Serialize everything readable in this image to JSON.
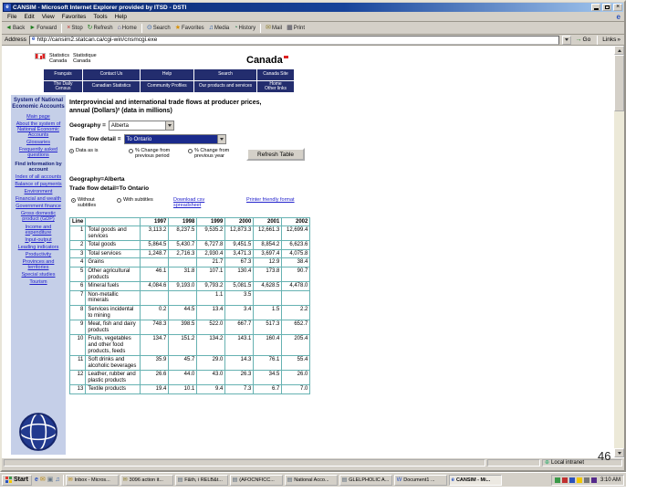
{
  "slide": {
    "page_number": "46"
  },
  "window": {
    "title": "CANSIM - Microsoft Internet Explorer provided by ITSD - DSTI",
    "menu": [
      "File",
      "Edit",
      "View",
      "Favorites",
      "Tools",
      "Help"
    ],
    "toolbar": [
      {
        "label": "Back",
        "icon": "back-arrow-icon"
      },
      {
        "label": "Forward",
        "icon": "forward-arrow-icon"
      },
      {
        "label": "Stop",
        "icon": "stop-icon"
      },
      {
        "label": "Refresh",
        "icon": "refresh-icon"
      },
      {
        "label": "Home",
        "icon": "home-icon"
      },
      {
        "label": "Search",
        "icon": "search-icon"
      },
      {
        "label": "Favorites",
        "icon": "favorites-icon"
      },
      {
        "label": "Media",
        "icon": "media-icon"
      },
      {
        "label": "History",
        "icon": "history-icon"
      },
      {
        "label": "Mail",
        "icon": "mail-icon"
      },
      {
        "label": "Print",
        "icon": "print-icon"
      }
    ],
    "address": {
      "label": "Address",
      "value": "http://cansim2.statcan.ca/cgi-win/cnsmcgi.exe",
      "go": "Go",
      "links": "Links"
    },
    "status": {
      "zone": "Local intranet"
    }
  },
  "site_header": {
    "signature": {
      "english": "Statistics\nCanada",
      "french": "Statistique\nCanada"
    },
    "wordmark": "Canada",
    "nav_row1": [
      "Français",
      "Contact Us",
      "Help",
      "Search",
      "Canada Site"
    ],
    "nav_row2": [
      "The Daily\nCensus",
      "Canadian Statistics",
      "Community Profiles",
      "Our products and services",
      "Home\nOther links"
    ]
  },
  "sidebar": {
    "title": "System of National Economic Accounts",
    "items": [
      {
        "label": "Main page",
        "type": "link"
      },
      {
        "label": "About the system of National Economic Accounts",
        "type": "link"
      },
      {
        "label": "Glossaries",
        "type": "link"
      },
      {
        "label": "Frequently asked questions",
        "type": "link"
      },
      {
        "label": "Find information by account",
        "type": "heading"
      },
      {
        "label": "Index of all accounts",
        "type": "link"
      },
      {
        "label": "Balance of payments",
        "type": "link"
      },
      {
        "label": "Environment",
        "type": "link"
      },
      {
        "label": "Financial and wealth",
        "type": "link"
      },
      {
        "label": "Government finance",
        "type": "link"
      },
      {
        "label": "Gross domestic product (GDP)",
        "type": "link"
      },
      {
        "label": "Income and expenditure",
        "type": "link"
      },
      {
        "label": "Input-output",
        "type": "link"
      },
      {
        "label": "Leading indicators",
        "type": "link"
      },
      {
        "label": "Productivity",
        "type": "link"
      },
      {
        "label": "Provinces and territories",
        "type": "link"
      },
      {
        "label": "Special studies",
        "type": "link"
      },
      {
        "label": "Tourism",
        "type": "link"
      }
    ]
  },
  "main": {
    "title_line1": "Interprovincial and international trade flows at producer prices,",
    "title_line2": "annual (Dollars)² (data in millions)",
    "geography_label": "Geography =",
    "geography_value": "Alberta",
    "flow_label": "Trade flow detail =",
    "flow_value": "To Ontario",
    "display_options": [
      "Data as is",
      "% Change from previous period",
      "% Change from previous year"
    ],
    "refresh_button": "Refresh Table",
    "selection_lines": [
      "Geography=Alberta",
      "Trade flow detail=To Ontario"
    ],
    "subtitle_options": [
      "Without subtitles",
      "With subtitles"
    ],
    "links": [
      "Download csv spreadsheet",
      "Printer friendly format"
    ],
    "table": {
      "corner": "Line",
      "years": [
        "1997",
        "1998",
        "1999",
        "2000",
        "2001",
        "2002"
      ],
      "rows": [
        {
          "line": "1",
          "desc": "Total goods and services",
          "values": [
            "3,113.2",
            "8,237.5",
            "9,535.2",
            "12,873.3",
            "12,661.3",
            "12,699.4"
          ]
        },
        {
          "line": "2",
          "desc": "Total goods",
          "values": [
            "5,864.5",
            "5,430.7",
            "6,727.8",
            "9,451.5",
            "8,854.2",
            "6,623.6"
          ]
        },
        {
          "line": "3",
          "desc": "Total services",
          "values": [
            "1,248.7",
            "2,716.3",
            "2,930.4",
            "3,471.3",
            "3,697.4",
            "4,075.8"
          ]
        },
        {
          "line": "4",
          "desc": "Grains",
          "values": [
            "",
            "",
            "21.7",
            "67.3",
            "12.9",
            "38.4"
          ]
        },
        {
          "line": "5",
          "desc": "Other agricultural products",
          "values": [
            "46.1",
            "31.8",
            "107.1",
            "130.4",
            "173.8",
            "90.7"
          ]
        },
        {
          "line": "6",
          "desc": "Mineral fuels",
          "values": [
            "4,084.6",
            "9,193.0",
            "9,793.2",
            "5,081.5",
            "4,628.5",
            "4,478.0"
          ]
        },
        {
          "line": "7",
          "desc": "Non-metallic minerals",
          "values": [
            "",
            "",
            "1.1",
            "3.5",
            "",
            ""
          ]
        },
        {
          "line": "8",
          "desc": "Services incidental to mining",
          "values": [
            "0.2",
            "44.5",
            "13.4",
            "3.4",
            "1.5",
            "2.2"
          ]
        },
        {
          "line": "9",
          "desc": "Meat, fish and dairy products",
          "values": [
            "748.3",
            "398.5",
            "522.0",
            "667.7",
            "517.3",
            "652.7"
          ]
        },
        {
          "line": "10",
          "desc": "Fruits, vegetables and other food products, feeds",
          "values": [
            "134.7",
            "151.2",
            "134.2",
            "143.1",
            "160.4",
            "205.4"
          ]
        },
        {
          "line": "11",
          "desc": "Soft drinks and alcoholic beverages",
          "values": [
            "35.9",
            "45.7",
            "29.0",
            "14.3",
            "76.1",
            "55.4"
          ]
        },
        {
          "line": "12",
          "desc": "Leather, rubber and plastic products",
          "values": [
            "26.6",
            "44.0",
            "43.0",
            "26.3",
            "34.5",
            "26.0"
          ]
        },
        {
          "line": "13",
          "desc": "Textile products",
          "values": [
            "19.4",
            "10.1",
            "9.4",
            "7.3",
            "6.7",
            "7.0"
          ]
        }
      ]
    }
  },
  "taskbar": {
    "start": "Start",
    "quick_launch": [
      "ie-icon",
      "outlook-icon",
      "show-desktop-icon",
      "media-player-icon"
    ],
    "buttons": [
      {
        "label": "Inbox - Micros...",
        "icon": "outlook-icon",
        "active": false
      },
      {
        "label": "3096 action it...",
        "icon": "mail-item-icon",
        "active": false
      },
      {
        "label": "F&th, i RELB&t...",
        "icon": "doc-icon",
        "active": false
      },
      {
        "label": "(AFOCNFICC...",
        "icon": "doc-icon",
        "active": false
      },
      {
        "label": "National Acco...",
        "icon": "doc-icon",
        "active": false
      },
      {
        "label": "GLELPHOLIC A...",
        "icon": "doc-icon",
        "active": false
      },
      {
        "label": "Document1 ...",
        "icon": "word-icon",
        "active": false
      },
      {
        "label": "CANSIM - Mi...",
        "icon": "ie-icon",
        "active": true
      }
    ],
    "tray_icon_colors": [
      "#3a9948",
      "#c03030",
      "#2a52be",
      "#f2c800",
      "#777777",
      "#552a8c"
    ],
    "clock": "3:10 AM"
  },
  "icons": {
    "back-arrow-icon": "◄",
    "forward-arrow-icon": "►",
    "stop-icon": "×",
    "refresh-icon": "↻",
    "home-icon": "⌂",
    "search-icon": "⊙",
    "favorites-icon": "★",
    "media-icon": "♫",
    "history-icon": "◔",
    "mail-icon": "✉",
    "print-icon": "▦",
    "ie-icon": "e",
    "go-icon": "→",
    "globe-icon": "⊕",
    "links-chevron-icon": "»",
    "outlook-icon": "✉",
    "mail-item-icon": "✉",
    "doc-icon": "▤",
    "word-icon": "W",
    "show-desktop-icon": "▣",
    "media-player-icon": "♫"
  }
}
